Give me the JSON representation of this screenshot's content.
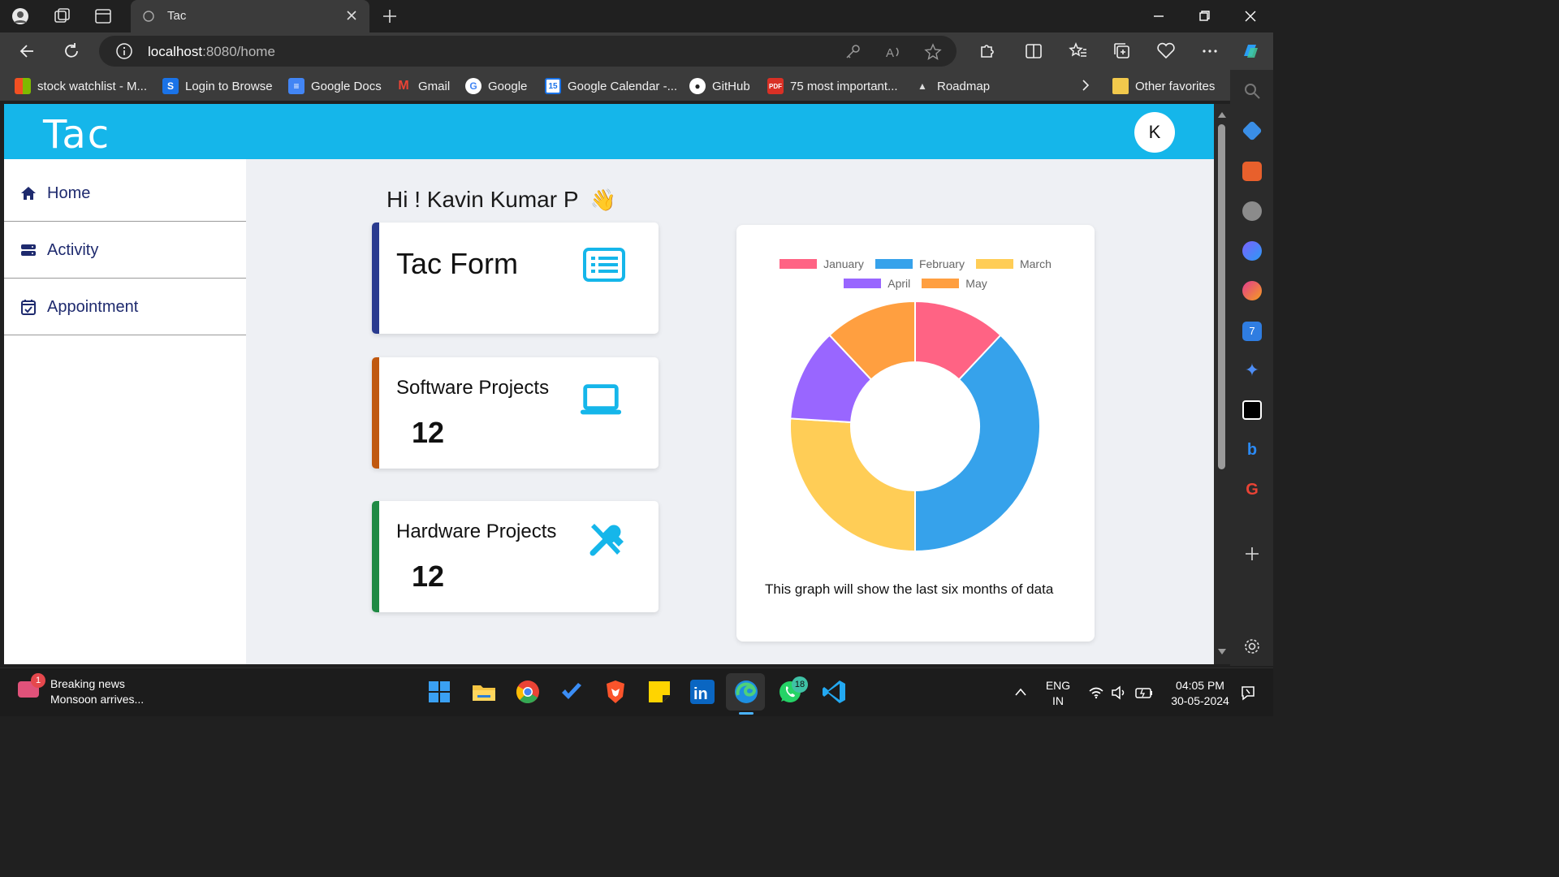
{
  "browser": {
    "tab_title": "Tac",
    "url_host": "localhost",
    "url_rest": ":8080/home",
    "bookmarks": [
      {
        "label": "stock watchlist - M...",
        "icon": "microsoft-icon"
      },
      {
        "label": "Login to Browse",
        "icon": "s-icon"
      },
      {
        "label": "Google Docs",
        "icon": "docs-icon"
      },
      {
        "label": "Gmail",
        "icon": "gmail-icon"
      },
      {
        "label": "Google",
        "icon": "google-icon"
      },
      {
        "label": "Google Calendar -...",
        "icon": "calendar-icon"
      },
      {
        "label": "GitHub",
        "icon": "github-icon"
      },
      {
        "label": "75 most important...",
        "icon": "pdf-icon"
      },
      {
        "label": "Roadmap",
        "icon": "rocket-icon"
      }
    ],
    "other_favorites": "Other favorites"
  },
  "app": {
    "logo": "Tac",
    "avatar_initial": "K",
    "nav": [
      {
        "label": "Home",
        "icon": "home-icon"
      },
      {
        "label": "Activity",
        "icon": "server-icon"
      },
      {
        "label": "Appointment",
        "icon": "calendar-check-icon"
      }
    ],
    "greeting": "Hi ! Kavin Kumar P",
    "greeting_emoji": "👋",
    "cards": [
      {
        "title": "Tac Form",
        "count": "",
        "icon": "list-icon",
        "accent": "#2a3b8f"
      },
      {
        "title": "Software Projects",
        "count": "12",
        "icon": "laptop-icon",
        "accent": "#c0580f"
      },
      {
        "title": "Hardware Projects",
        "count": "12",
        "icon": "tools-icon",
        "accent": "#1f8a44"
      }
    ],
    "chart_caption": "This graph will show the last six months of data"
  },
  "chart_data": {
    "type": "pie",
    "variant": "doughnut",
    "categories": [
      "January",
      "February",
      "March",
      "April",
      "May"
    ],
    "values": [
      12,
      38,
      26,
      12,
      12
    ],
    "colors": [
      "#ff6384",
      "#36a2eb",
      "#ffcd56",
      "#9966ff",
      "#ff9f40"
    ],
    "legend_position": "top"
  },
  "taskbar": {
    "news_title": "Breaking news",
    "news_sub": "Monsoon arrives...",
    "news_badge": "1",
    "whatsapp_badge": "18",
    "lang_1": "ENG",
    "lang_2": "IN",
    "time": "04:05 PM",
    "date": "30-05-2024"
  }
}
